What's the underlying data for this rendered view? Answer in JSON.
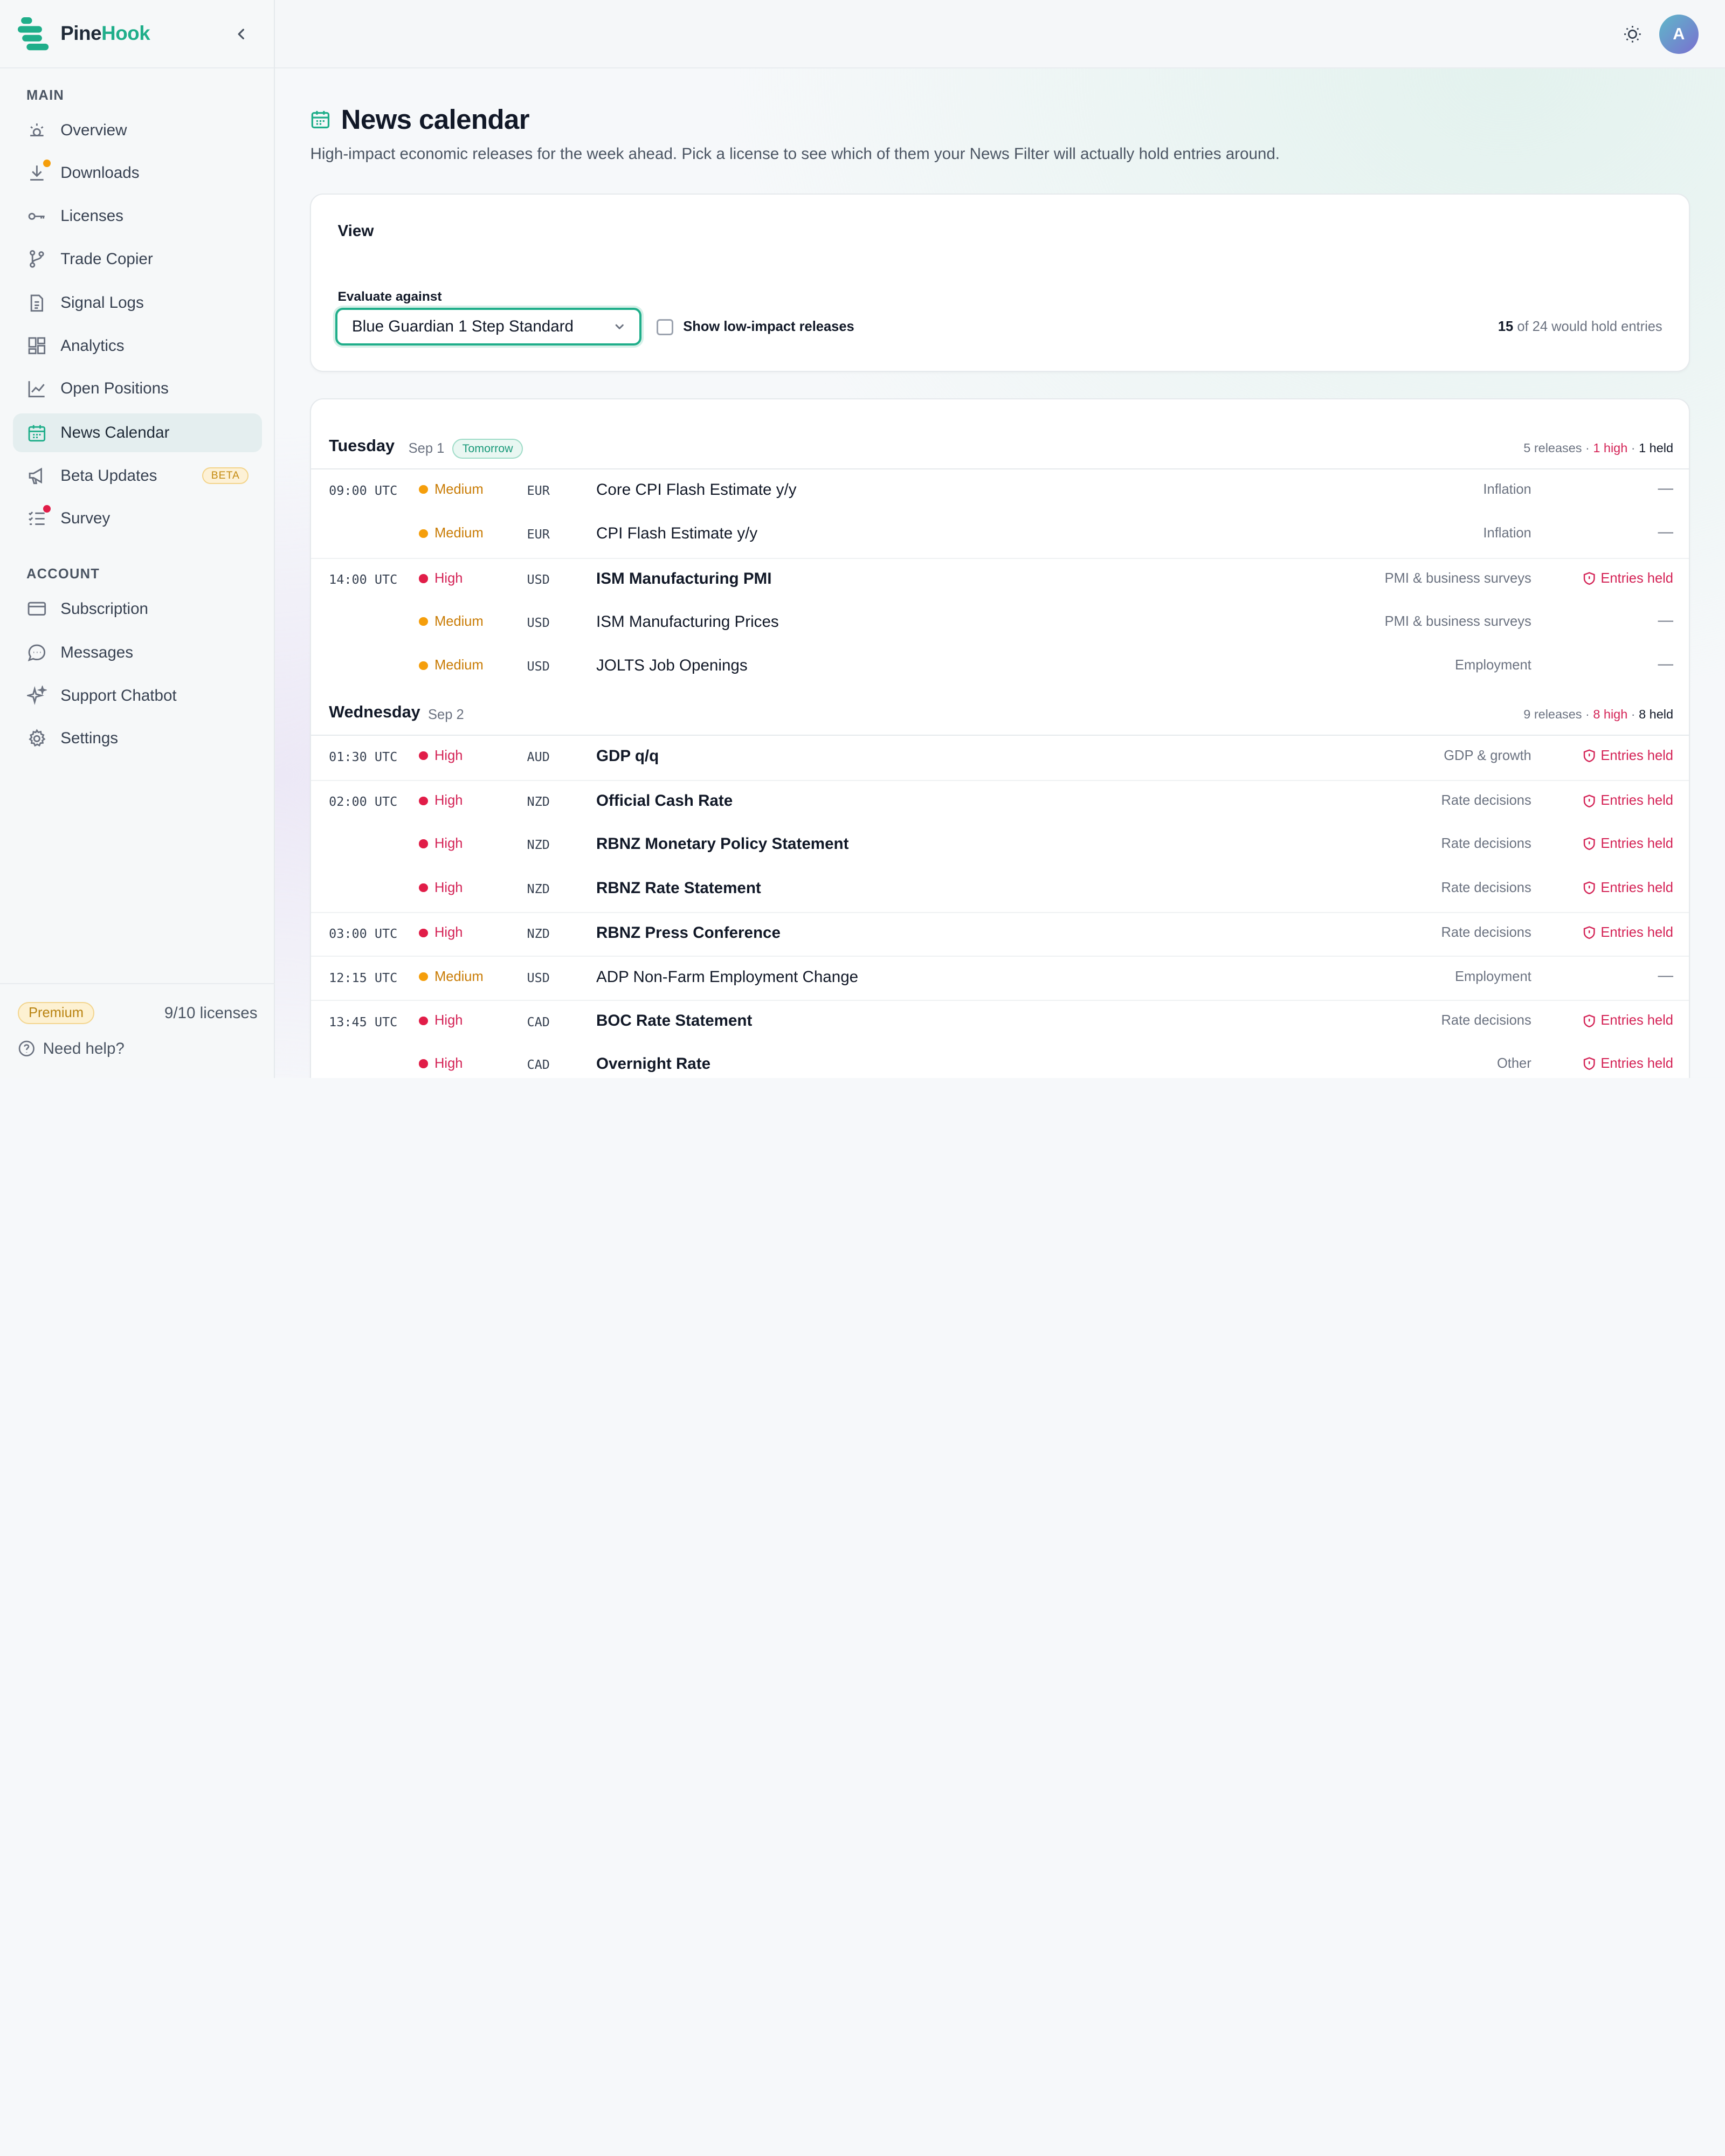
{
  "brand": {
    "name_a": "Pine",
    "name_b": "Hook",
    "accent": "#1fae8a"
  },
  "sidebar": {
    "main_label": "MAIN",
    "account_label": "ACCOUNT",
    "items": [
      {
        "label": "Overview",
        "icon": "sun-dial-icon"
      },
      {
        "label": "Downloads",
        "icon": "download-icon",
        "badge": "#f59e0b"
      },
      {
        "label": "Licenses",
        "icon": "key-icon"
      },
      {
        "label": "Trade Copier",
        "icon": "git-branch-icon"
      },
      {
        "label": "Signal Logs",
        "icon": "document-icon"
      },
      {
        "label": "Analytics",
        "icon": "dashboard-icon"
      },
      {
        "label": "Open Positions",
        "icon": "line-chart-icon"
      },
      {
        "label": "News Calendar",
        "icon": "calendar-icon",
        "active": true
      },
      {
        "label": "Beta Updates",
        "icon": "megaphone-icon",
        "tag": "BETA"
      },
      {
        "label": "Survey",
        "icon": "list-check-icon",
        "badge": "#e11d48"
      }
    ],
    "account_items": [
      {
        "label": "Subscription",
        "icon": "card-icon"
      },
      {
        "label": "Messages",
        "icon": "chat-icon"
      },
      {
        "label": "Support Chatbot",
        "icon": "sparkle-icon"
      },
      {
        "label": "Settings",
        "icon": "gear-icon"
      }
    ],
    "footer": {
      "plan": "Premium",
      "licenses": "9/10 licenses",
      "help": "Need help?"
    }
  },
  "topbar": {
    "avatar_initial": "A"
  },
  "page": {
    "title": "News calendar",
    "subtitle": "High-impact economic releases for the week ahead. Pick a license to see which of them your News Filter will actually hold entries around."
  },
  "view": {
    "title": "View",
    "evaluate_label": "Evaluate against",
    "selected_license": "Blue Guardian 1 Step Standard",
    "checkbox_label": "Show low-impact releases",
    "checkbox_checked": false,
    "hold_count": "15",
    "hold_rest": "of 24 would hold entries"
  },
  "days": [
    {
      "name": "Tuesday",
      "date": "Sep 1",
      "badge": "Tomorrow",
      "stats": {
        "releases": "5 releases",
        "high": "1 high",
        "held": "1 held"
      },
      "rows": [
        {
          "time": "09:00 UTC",
          "impact": "Medium",
          "ccy": "EUR",
          "title": "Core CPI Flash Estimate y/y",
          "category": "Inflation",
          "status": "—"
        },
        {
          "time": "",
          "impact": "Medium",
          "ccy": "EUR",
          "title": "CPI Flash Estimate y/y",
          "category": "Inflation",
          "status": "—"
        },
        {
          "time": "14:00 UTC",
          "impact": "High",
          "ccy": "USD",
          "title": "ISM Manufacturing PMI",
          "category": "PMI & business surveys",
          "status": "Entries held"
        },
        {
          "time": "",
          "impact": "Medium",
          "ccy": "USD",
          "title": "ISM Manufacturing Prices",
          "category": "PMI & business surveys",
          "status": "—"
        },
        {
          "time": "",
          "impact": "Medium",
          "ccy": "USD",
          "title": "JOLTS Job Openings",
          "category": "Employment",
          "status": "—"
        }
      ]
    },
    {
      "name": "Wednesday",
      "date": "Sep 2",
      "stats": {
        "releases": "9 releases",
        "high": "8 high",
        "held": "8 held"
      },
      "rows": [
        {
          "time": "01:30 UTC",
          "impact": "High",
          "ccy": "AUD",
          "title": "GDP q/q",
          "category": "GDP & growth",
          "status": "Entries held"
        },
        {
          "time": "02:00 UTC",
          "impact": "High",
          "ccy": "NZD",
          "title": "Official Cash Rate",
          "category": "Rate decisions",
          "status": "Entries held"
        },
        {
          "time": "",
          "impact": "High",
          "ccy": "NZD",
          "title": "RBNZ Monetary Policy Statement",
          "category": "Rate decisions",
          "status": "Entries held"
        },
        {
          "time": "",
          "impact": "High",
          "ccy": "NZD",
          "title": "RBNZ Rate Statement",
          "category": "Rate decisions",
          "status": "Entries held"
        },
        {
          "time": "03:00 UTC",
          "impact": "High",
          "ccy": "NZD",
          "title": "RBNZ Press Conference",
          "category": "Rate decisions",
          "status": "Entries held"
        },
        {
          "time": "12:15 UTC",
          "impact": "Medium",
          "ccy": "USD",
          "title": "ADP Non-Farm Employment Change",
          "category": "Employment",
          "status": "—"
        },
        {
          "time": "13:45 UTC",
          "impact": "High",
          "ccy": "CAD",
          "title": "BOC Rate Statement",
          "category": "Rate decisions",
          "status": "Entries held"
        },
        {
          "time": "",
          "impact": "High",
          "ccy": "CAD",
          "title": "Overnight Rate",
          "category": "Other",
          "status": "Entries held"
        }
      ]
    }
  ],
  "colors": {
    "high": "#e11d48",
    "medium": "#f59e0b",
    "high_text": "#d42356",
    "medium_text": "#c97c06"
  }
}
